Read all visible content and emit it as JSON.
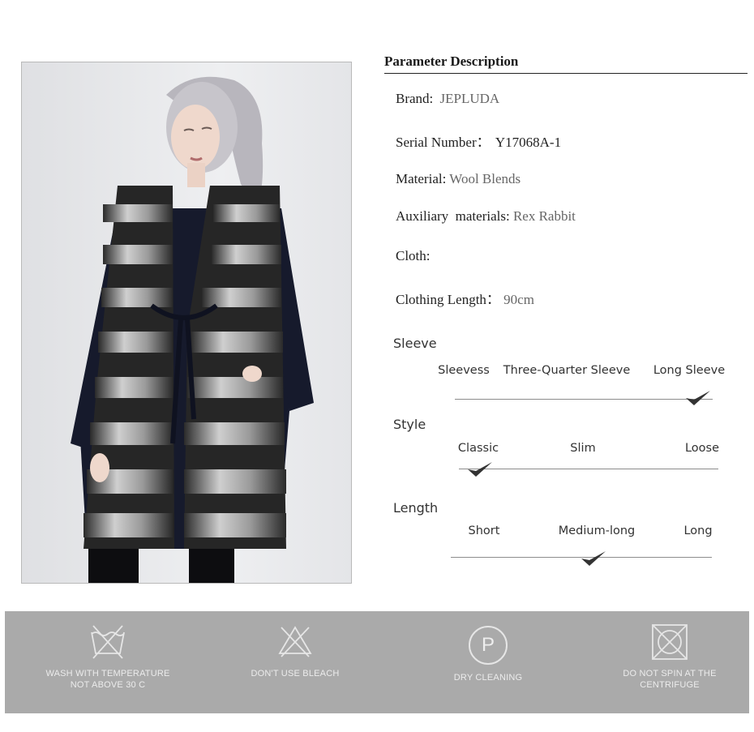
{
  "parameters": {
    "title": "Parameter Description",
    "brand": {
      "label": "Brand:",
      "value": "JEPLUDA"
    },
    "serial": {
      "label": "Serial Number：",
      "value": "Y17068A-1"
    },
    "material": {
      "label": "Material:",
      "value": "Wool Blends"
    },
    "auxiliary": {
      "label": "Auxiliary  materials:",
      "value": "Rex Rabbit"
    },
    "cloth": {
      "label": "Cloth:",
      "value": ""
    },
    "length": {
      "label": "Clothing Length：",
      "value": "90cm"
    }
  },
  "sleeve": {
    "title": "Sleeve",
    "options": [
      "Sleevess",
      "Three-Quarter Sleeve",
      "Long Sleeve"
    ],
    "selected": "Long Sleeve"
  },
  "style": {
    "title": "Style",
    "options": [
      "Classic",
      "Slim",
      "Loose"
    ],
    "selected": "Classic"
  },
  "length_spec": {
    "title": "Length",
    "options": [
      "Short",
      "Medium-long",
      "Long"
    ],
    "selected": "Medium-long"
  },
  "care": {
    "wash": {
      "line1": "WASH WITH TEMPERATURE",
      "line2": "NOT ABOVE 30 C",
      "icon": "wash-tub-crossed-icon"
    },
    "bleach": {
      "line1": "DON'T USE BLEACH",
      "icon": "bleach-triangle-crossed-icon"
    },
    "dry": {
      "line1": "DRY CLEANING",
      "symbol": "P",
      "icon": "dry-clean-p-icon"
    },
    "spin": {
      "line1": "DO NOT SPIN AT THE",
      "line2": "CENTRIFUGE",
      "icon": "tumble-dry-crossed-icon"
    }
  },
  "colors": {
    "care_band": "#aaaaaa",
    "care_text": "#ececec",
    "checkmark": "#333333"
  }
}
